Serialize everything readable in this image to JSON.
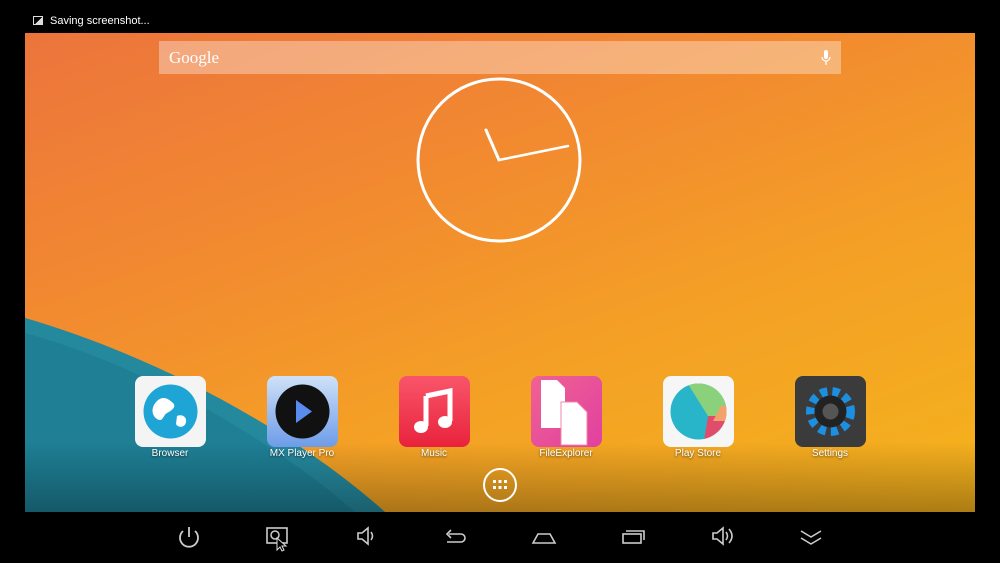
{
  "status_bar": {
    "notification_icon": "image-icon",
    "notification_text": "Saving screenshot..."
  },
  "search": {
    "placeholder": "Google",
    "icon": "mic-icon"
  },
  "clock": {
    "type": "analog",
    "hour_hand": "11",
    "minute_hand": "14"
  },
  "apps": [
    {
      "label": "Browser",
      "icon": "globe-icon",
      "color": "#1ea5d6"
    },
    {
      "label": "MX Player Pro",
      "icon": "play-icon",
      "color": "#7ab0f0"
    },
    {
      "label": "Music",
      "icon": "music-note-icon",
      "color": "#f03a4e"
    },
    {
      "label": "FileExplorer",
      "icon": "files-icon",
      "color": "#ec4fa0"
    },
    {
      "label": "Play Store",
      "icon": "play-store-icon",
      "color": "#ffffff"
    },
    {
      "label": "Settings",
      "icon": "gear-icon",
      "color": "#3a3a3a"
    }
  ],
  "app_drawer": {
    "icon": "app-drawer-icon"
  },
  "nav_bar": [
    "power-icon",
    "screenshot-icon",
    "volume-down-icon",
    "back-icon",
    "home-icon",
    "recents-icon",
    "volume-up-icon",
    "hide-bar-icon"
  ]
}
